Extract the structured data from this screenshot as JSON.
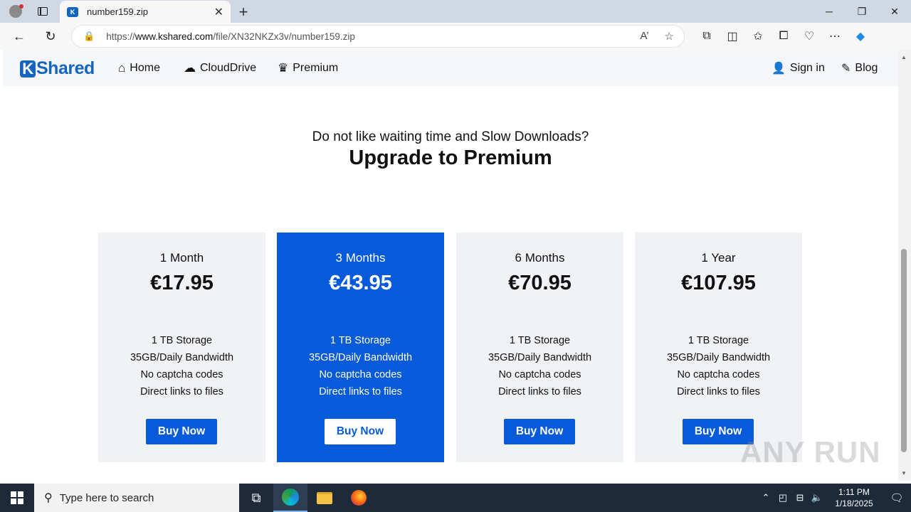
{
  "browser": {
    "tab_title": "number159.zip",
    "url_prefix": "https://",
    "url_host": "www.kshared.com",
    "url_path": "/file/XN32NKZx3v/number159.zip"
  },
  "site": {
    "logo_text": "Shared",
    "logo_initial": "K",
    "nav": {
      "home": "Home",
      "clouddrive": "CloudDrive",
      "premium": "Premium",
      "signin": "Sign in",
      "blog": "Blog"
    }
  },
  "hero": {
    "subtitle": "Do not like waiting time and Slow Downloads?",
    "title": "Upgrade to Premium"
  },
  "plans": [
    {
      "duration": "1 Month",
      "price": "€17.95",
      "features": [
        "1 TB Storage",
        "35GB/Daily Bandwidth",
        "No captcha codes",
        "Direct links to files"
      ],
      "button": "Buy Now"
    },
    {
      "duration": "3 Months",
      "price": "€43.95",
      "features": [
        "1 TB Storage",
        "35GB/Daily Bandwidth",
        "No captcha codes",
        "Direct links to files"
      ],
      "button": "Buy Now"
    },
    {
      "duration": "6 Months",
      "price": "€70.95",
      "features": [
        "1 TB Storage",
        "35GB/Daily Bandwidth",
        "No captcha codes",
        "Direct links to files"
      ],
      "button": "Buy Now"
    },
    {
      "duration": "1 Year",
      "price": "€107.95",
      "features": [
        "1 TB Storage",
        "35GB/Daily Bandwidth",
        "No captcha codes",
        "Direct links to files"
      ],
      "button": "Buy Now"
    }
  ],
  "watermark": "ANY RUN",
  "taskbar": {
    "search_placeholder": "Type here to search",
    "time": "1:11 PM",
    "date": "1/18/2025"
  },
  "colors": {
    "accent": "#075ad9",
    "card_bg": "#f0f2f5",
    "header_bg": "#f4f6fa"
  }
}
